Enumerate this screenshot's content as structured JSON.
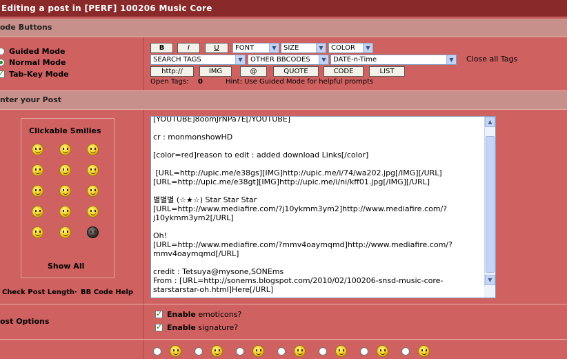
{
  "window": {
    "title": "Editing a post in [PERF] 100206 Music Core"
  },
  "code_buttons": {
    "heading": "ode Buttons",
    "modes": [
      {
        "label": "Guided Mode",
        "checked": false
      },
      {
        "label": "Normal Mode",
        "checked": true
      },
      {
        "label": "Tab-Key Mode",
        "checked": true
      }
    ],
    "buttons_row1": [
      "B",
      "I",
      "U"
    ],
    "font_select": "FONT",
    "size_select": "SIZE",
    "color_select": "COLOR",
    "search_tags_select": "SEARCH TAGS",
    "other_bbcodes_select": "OTHER BBCODES",
    "date_select": "DATE-n-Time",
    "close_all_tags": "Close all Tags",
    "buttons_row3": [
      "http://",
      "IMG",
      "@",
      "QUOTE",
      "CODE",
      "LIST"
    ],
    "open_tags_label": "Open Tags:",
    "open_tags_count": "0",
    "hint": "Hint: Use Guided Mode for helpful prompts"
  },
  "enter_post": {
    "heading": "nter your Post",
    "smilies_title": "Clickable Smilies",
    "show_all": "Show All",
    "check_length": "Check Post Length",
    "separator": "·",
    "bb_code_help": "BB Code Help",
    "content": "[YOUTUBE]8oomJrNPa7E[/YOUTUBE]\n\ncr : monmonshowHD\n\n[color=red]reason to edit : added download Links[/color]\n\n [URL=http://upic.me/e38gs][IMG]http://upic.me/i/74/wa202.jpg[/IMG][/URL]\n[URL=http://upic.me/e38gt][IMG]http://upic.me/i/ni/kff01.jpg[/IMG][/URL]\n\n별별별 (☆★☆) Star Star Star\n[URL=http://www.mediafire.com/?j10ykmm3ym2]http://www.mediafire.com/?j10ykmm3ym2[/URL]\n\nOh!\n[URL=http://www.mediafire.com/?mmv4oaymqmd]http://www.mediafire.com/?mmv4oaymqmd[/URL]\n\ncredit : Tetsuya@mysone,SONEms\nFrom : [URL=http://sonems.blogspot.com/2010/02/100206-snsd-music-core-starstarstar-oh.html]Here[/URL]"
  },
  "post_options": {
    "heading": "ost Options",
    "enable_emoticons_bold": "Enable",
    "enable_emoticons_rest": "emoticons?",
    "enable_signature_bold": "Enable",
    "enable_signature_rest": "signature?"
  }
}
